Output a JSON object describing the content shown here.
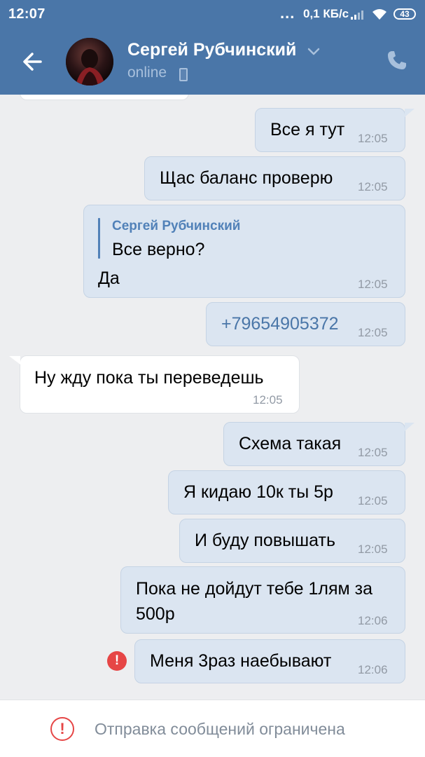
{
  "status_bar": {
    "time": "12:07",
    "dots": "...",
    "net_speed": "0,1 КБ/с",
    "battery": "43"
  },
  "header": {
    "name": "Сергей Рубчинский",
    "status": "online"
  },
  "messages": [
    {
      "direction": "out",
      "text": "Все я тут",
      "time": "12:05"
    },
    {
      "direction": "out",
      "text": "Щас баланс проверю",
      "time": "12:05"
    },
    {
      "direction": "out",
      "reply_author": "Сергей Рубчинский",
      "reply_text": "Все верно?",
      "text": "Да",
      "time": "12:05"
    },
    {
      "direction": "out",
      "text": "+79654905372",
      "time": "12:05",
      "is_link": true
    },
    {
      "direction": "in",
      "text": "Ну жду пока ты переведешь",
      "time": "12:05"
    },
    {
      "direction": "out",
      "text": "Схема такая",
      "time": "12:05"
    },
    {
      "direction": "out",
      "text": "Я кидаю 10к ты 5р",
      "time": "12:05"
    },
    {
      "direction": "out",
      "text": "И буду повышать",
      "time": "12:05"
    },
    {
      "direction": "out",
      "text_line1": "Пока не дойдут тебе 1лям за",
      "text_line2": "500р",
      "time": "12:06"
    },
    {
      "direction": "out",
      "text": "Меня 3раз наебывают",
      "time": "12:06",
      "error": true
    }
  ],
  "error_icon": "!",
  "footer": {
    "icon": "!",
    "text": "Отправка сообщений ограничена"
  },
  "colors": {
    "header_bg": "#4a76a8",
    "chat_bg": "#edeef0",
    "out_bubble": "#dbe5f1",
    "in_bubble": "#ffffff",
    "link": "#4a76a8",
    "error": "#e64646"
  }
}
